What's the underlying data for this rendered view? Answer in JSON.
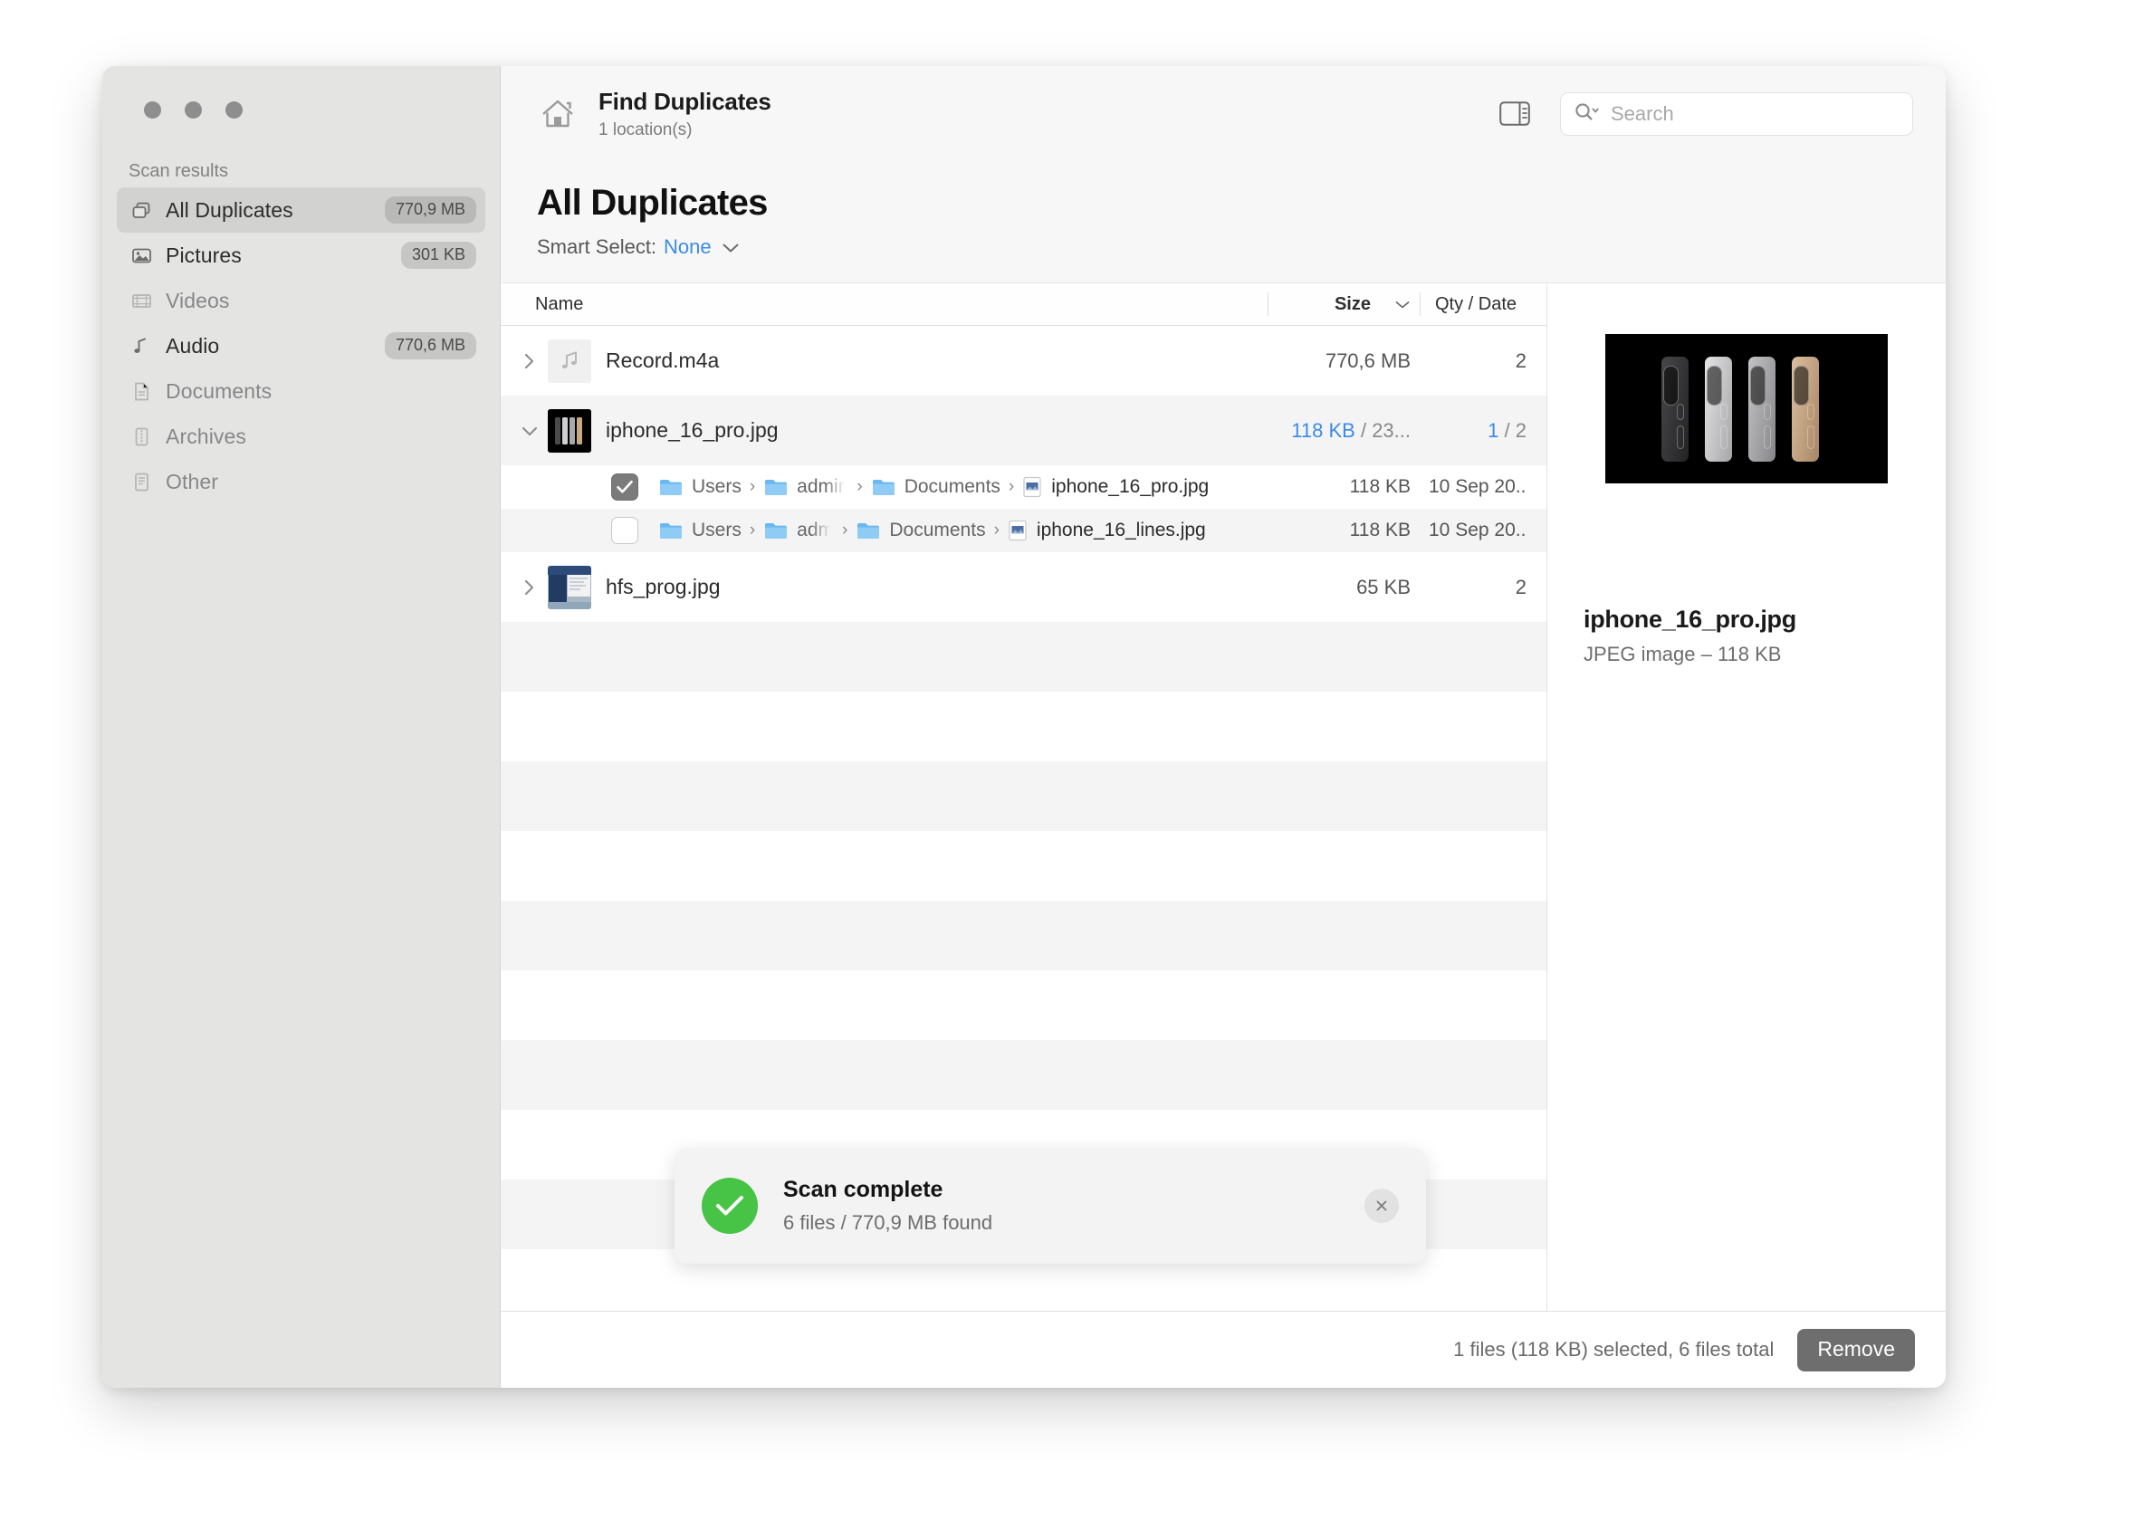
{
  "window": {
    "traffic_lights": [
      "close",
      "minimize",
      "maximize"
    ]
  },
  "sidebar": {
    "section_label": "Scan results",
    "items": [
      {
        "label": "All Duplicates",
        "badge": "770,9 MB",
        "icon": "duplicates-icon",
        "active": true,
        "dim": false
      },
      {
        "label": "Pictures",
        "badge": "301 KB",
        "icon": "pictures-icon",
        "active": false,
        "dim": false
      },
      {
        "label": "Videos",
        "badge": "",
        "icon": "videos-icon",
        "active": false,
        "dim": true
      },
      {
        "label": "Audio",
        "badge": "770,6 MB",
        "icon": "audio-icon",
        "active": false,
        "dim": false
      },
      {
        "label": "Documents",
        "badge": "",
        "icon": "documents-icon",
        "active": false,
        "dim": true
      },
      {
        "label": "Archives",
        "badge": "",
        "icon": "archives-icon",
        "active": false,
        "dim": true
      },
      {
        "label": "Other",
        "badge": "",
        "icon": "other-icon",
        "active": false,
        "dim": true
      }
    ]
  },
  "toolbar": {
    "home_icon": "home-icon",
    "title": "Find Duplicates",
    "subtitle": "1 location(s)",
    "panel_toggle_icon": "sidebar-panel-toggle-icon",
    "search": {
      "icon": "search-icon",
      "value": "",
      "placeholder": "Search"
    }
  },
  "section": {
    "title": "All Duplicates",
    "smart_select_label": "Smart Select:",
    "smart_select_value": "None",
    "smart_select_chevron": "chevron-down-icon"
  },
  "table": {
    "columns": {
      "name": "Name",
      "size": "Size",
      "sort_icon": "chevron-down-icon",
      "qty_date": "Qty / Date"
    },
    "rows": [
      {
        "name": "Record.m4a",
        "thumb": "audio-note-thumb",
        "size": "770,6 MB",
        "size_highlight": "",
        "qty": "2",
        "qty_highlight": "",
        "expanded": false,
        "children": []
      },
      {
        "name": "iphone_16_pro.jpg",
        "thumb": "iphone-photo-thumb",
        "size": "",
        "size_selected": "118 KB",
        "size_separator": " / ",
        "size_total": "23...",
        "qty_selected": "1",
        "qty_separator": " / ",
        "qty_total": "2",
        "expanded": true,
        "children": [
          {
            "checked": true,
            "path": [
              "Users",
              "admin",
              "Documents"
            ],
            "path_truncated_index": 1,
            "file_icon": "jpeg-file-icon",
            "file_name": "iphone_16_pro.jpg",
            "size": "118 KB",
            "date": "10 Sep 20.."
          },
          {
            "checked": false,
            "path": [
              "Users",
              "adm",
              "Documents"
            ],
            "path_truncated_index": 1,
            "file_icon": "jpeg-file-icon",
            "file_name": "iphone_16_lines.jpg",
            "size": "118 KB",
            "date": "10 Sep 20.."
          }
        ]
      },
      {
        "name": "hfs_prog.jpg",
        "thumb": "screenshot-thumb",
        "size": "65 KB",
        "size_highlight": "",
        "qty": "2",
        "qty_highlight": "",
        "expanded": false,
        "children": []
      }
    ]
  },
  "preview": {
    "image_alt": "iphone-16-pro-lineup",
    "file_name": "iphone_16_pro.jpg",
    "file_meta": "JPEG image – 118 KB",
    "phone_colors": [
      "#3a3a3c",
      "#c9c9cb",
      "#a8a8aa",
      "#c6a584"
    ]
  },
  "toast": {
    "icon": "success-check-icon",
    "title": "Scan complete",
    "subtitle": "6 files / 770,9 MB found",
    "close_icon": "close-icon"
  },
  "footer": {
    "status": "1 files (118 KB) selected, 6 files total",
    "remove_label": "Remove"
  },
  "colors": {
    "accent_blue": "#3b8bea",
    "success_green": "#47c346",
    "sidebar_bg": "#e4e4e2",
    "header_bg": "#f7f7f7",
    "stripe": "#f4f4f4",
    "remove_button": "#6e6e6e"
  }
}
